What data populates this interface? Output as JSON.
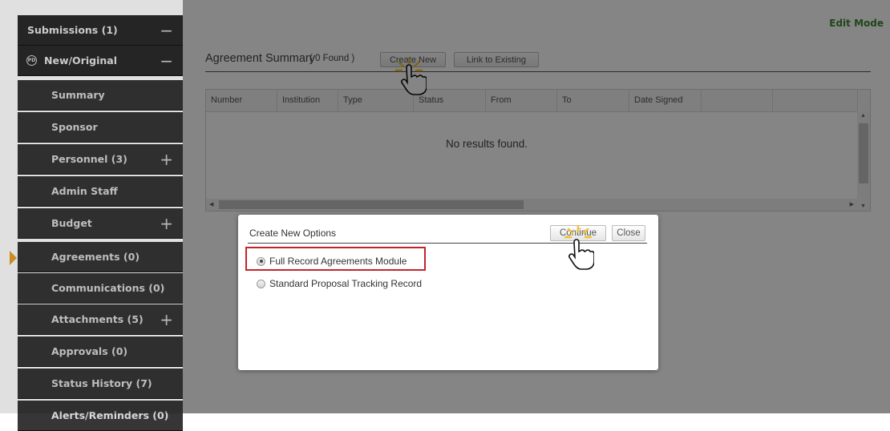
{
  "app": {
    "edit_mode": "Edit Mode"
  },
  "sidebar": {
    "items": [
      {
        "label": "Submissions (1)",
        "sign": "−"
      },
      {
        "label": "New/Original",
        "sign": "−",
        "icon": "PD"
      },
      {
        "label": "Summary",
        "sign": ""
      },
      {
        "label": "Sponsor",
        "sign": ""
      },
      {
        "label": "Personnel (3)",
        "sign": "+"
      },
      {
        "label": "Admin Staff",
        "sign": ""
      },
      {
        "label": "Budget",
        "sign": "+"
      },
      {
        "label": "Agreements (0)",
        "sign": ""
      },
      {
        "label": "Communications (0)",
        "sign": ""
      },
      {
        "label": "Attachments (5)",
        "sign": "+"
      },
      {
        "label": "Approvals (0)",
        "sign": ""
      },
      {
        "label": "Status History (7)",
        "sign": ""
      },
      {
        "label": "Alerts/Reminders (0)",
        "sign": ""
      }
    ],
    "active_item": "Agreements (0)",
    "active_color": "#e8a02a"
  },
  "agreement": {
    "title": "Agreement Summary",
    "found": "( 0 Found )",
    "create_new": "Create New",
    "link_existing": "Link to Existing",
    "columns": [
      "Number",
      "Institution",
      "Type",
      "Status",
      "From",
      "To",
      "Date Signed",
      "",
      ""
    ],
    "no_results": "No results found."
  },
  "dialog": {
    "title": "Create New Options",
    "continue": "Continue",
    "close": "Close",
    "options": [
      {
        "label": "Full Record Agreements Module",
        "checked": true
      },
      {
        "label": "Standard Proposal Tracking Record",
        "checked": false
      }
    ],
    "highlight_color": "#c0262b"
  },
  "icons": {
    "cursor": "hand-pointer-icon",
    "click_burst": "click-burst-icon"
  }
}
